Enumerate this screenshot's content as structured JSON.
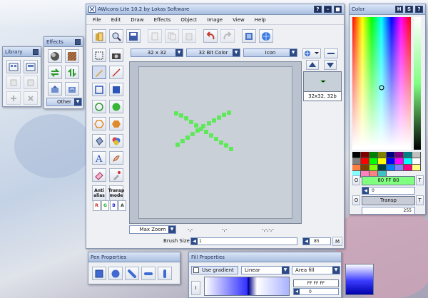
{
  "main_window": {
    "title": "AWicons Lite 10.2 by Lokas Software",
    "menu": [
      "File",
      "Edit",
      "Draw",
      "Effects",
      "Object",
      "Image",
      "View",
      "Help"
    ],
    "size_select": "32 x 32",
    "color_select": "32 Bit Color",
    "type_select": "Icon",
    "thumb_label": "32x32, 32b",
    "zoom_select": "Max Zoom",
    "coord1": "-,-",
    "coord2": "-,-",
    "coord3": "-,-,-,-",
    "brush_label": "Brush Size",
    "brush_value": "1",
    "zoom_value": "85",
    "m_button": "M",
    "anti_alias": "Anti\nalias",
    "transp_mode": "Transp\nmode",
    "channels": [
      "R",
      "G",
      "B",
      "A"
    ]
  },
  "library": {
    "title": "Library"
  },
  "effects": {
    "title": "Effects",
    "other_label": "Other"
  },
  "color_panel": {
    "title": "Color",
    "hex_value": "80 FF 80",
    "o_label": "O",
    "t_label": "T",
    "slider_value": "0",
    "transp_label": "Transp",
    "alpha_value": "255",
    "palette": [
      "#000000",
      "#800000",
      "#008000",
      "#808000",
      "#000080",
      "#800080",
      "#008080",
      "#c0c0c0",
      "#808080",
      "#ff0000",
      "#00ff00",
      "#ffff00",
      "#0000ff",
      "#ff00ff",
      "#00ffff",
      "#ffffff",
      "#ff8040",
      "#804000",
      "#80ff00",
      "#004040",
      "#0080ff",
      "#8080ff",
      "#ff0080",
      "#ffff80",
      "#80ffff",
      "#ff80c0",
      "#ff8080",
      "#40c0c0"
    ]
  },
  "pen_panel": {
    "title": "Pen Properties"
  },
  "fill_panel": {
    "title": "Fill Properties",
    "use_gradient": "Use gradient",
    "gradient_type": "Linear",
    "fill_area": "Area fill",
    "hex_value": "FF FF FF",
    "i_label": "I",
    "value": "0"
  },
  "colors": {
    "accent": "#2c4a86",
    "selected": "#80ff80"
  }
}
